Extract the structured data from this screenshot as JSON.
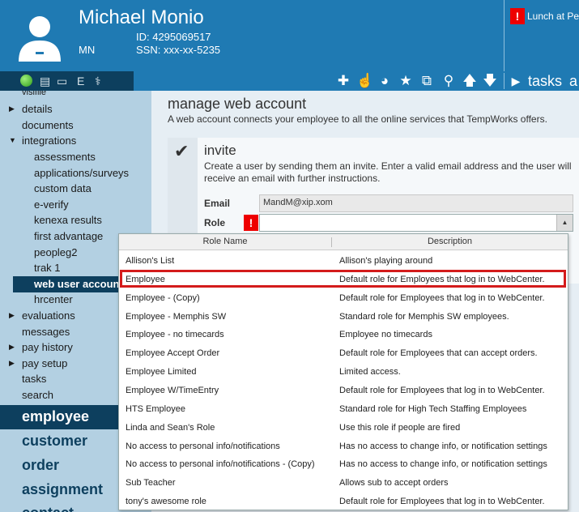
{
  "header": {
    "name": "Michael Monio",
    "id": "ID: 4295069517",
    "state": "MN",
    "ssn": "SSN: xxx-xx-5235",
    "alert_badge": "!",
    "alert_text": "Lunch at Per"
  },
  "toolbar": {
    "status_e": "E",
    "tasks": "tasks",
    "tasks_tail": "a"
  },
  "sidebar": {
    "partial_top": "visifile",
    "items": [
      {
        "label": "details"
      },
      {
        "label": "documents"
      },
      {
        "label": "integrations"
      },
      {
        "label": "assessments"
      },
      {
        "label": "applications/surveys"
      },
      {
        "label": "custom data"
      },
      {
        "label": "e-verify"
      },
      {
        "label": "kenexa results"
      },
      {
        "label": "first advantage"
      },
      {
        "label": "peopleg2"
      },
      {
        "label": "trak 1"
      },
      {
        "label": "web user accounts"
      },
      {
        "label": "hrcenter"
      },
      {
        "label": "evaluations"
      },
      {
        "label": "messages"
      },
      {
        "label": "pay history"
      },
      {
        "label": "pay setup"
      },
      {
        "label": "tasks"
      },
      {
        "label": "search"
      }
    ],
    "big": [
      {
        "label": "employee"
      },
      {
        "label": "customer"
      },
      {
        "label": "order"
      },
      {
        "label": "assignment"
      },
      {
        "label": "contact"
      }
    ]
  },
  "main": {
    "title": "manage web account",
    "description": "A web account connects your employee to all the online services that TempWorks offers.",
    "invite": {
      "title": "invite",
      "description": "Create a user by sending them an invite. Enter a valid email address and the user will receive an email with further instructions.",
      "email_label": "Email",
      "email_value": "MandM@xip.xom",
      "role_label": "Role",
      "role_badge": "!",
      "role_value": ""
    }
  },
  "dropdown": {
    "col_name": "Role Name",
    "col_desc": "Description",
    "rows": [
      {
        "name": "Allison's List",
        "desc": "Allison's playing around"
      },
      {
        "name": "Employee",
        "desc": "Default role for Employees that log in to WebCenter."
      },
      {
        "name": "Employee - (Copy)",
        "desc": "Default role for Employees that log in to WebCenter."
      },
      {
        "name": "Employee - Memphis SW",
        "desc": "Standard role for Memphis SW employees."
      },
      {
        "name": "Employee - no timecards",
        "desc": "Employee no timecards"
      },
      {
        "name": "Employee Accept Order",
        "desc": "Default role for Employees that can accept orders."
      },
      {
        "name": "Employee Limited",
        "desc": "Limited access."
      },
      {
        "name": "Employee W/TimeEntry",
        "desc": "Default role for Employees that log in to WebCenter."
      },
      {
        "name": "HTS Employee",
        "desc": "Standard role for High Tech Staffing Employees"
      },
      {
        "name": "Linda and Sean's Role",
        "desc": "Use this role if people are fired"
      },
      {
        "name": "No access to personal info/notifications",
        "desc": "Has no access to change info, or notification settings"
      },
      {
        "name": "No access to personal info/notifications - (Copy)",
        "desc": "Has no access to change info, or notification settings"
      },
      {
        "name": "Sub Teacher",
        "desc": "Allows sub to accept orders"
      },
      {
        "name": "tony's awesome role",
        "desc": "Default role for Employees that log in to WebCenter."
      }
    ],
    "highlight_color": "#d41b1b"
  },
  "colors": {
    "header_blue": "#1f7ab3",
    "dark_navy": "#0d3f5e",
    "sidebar_bg": "#b3d0e2",
    "alert_red": "#e00"
  }
}
